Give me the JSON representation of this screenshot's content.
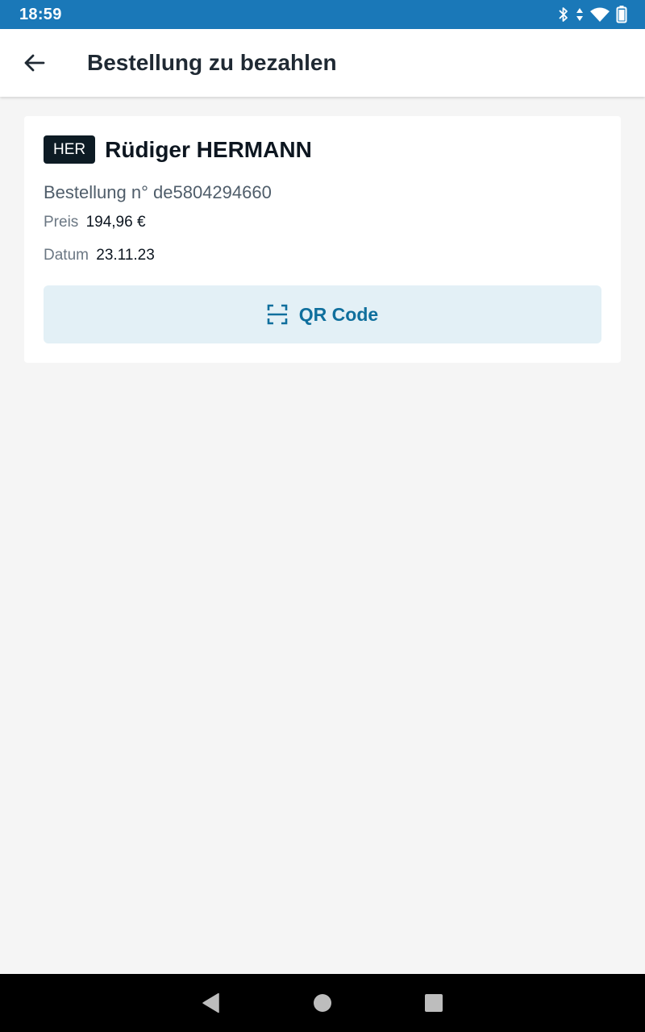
{
  "status_bar": {
    "time": "18:59",
    "icons": [
      "bluetooth-icon",
      "data-arrows-icon",
      "wifi-icon",
      "battery-icon"
    ]
  },
  "app_bar": {
    "back_icon": "arrow-left-icon",
    "title": "Bestellung zu bezahlen"
  },
  "order": {
    "badge": "HER",
    "customer_name": "Rüdiger HERMANN",
    "order_number_text": "Bestellung n° de5804294660",
    "price_label": "Preis",
    "price_value": "194,96 €",
    "date_label": "Datum",
    "date_value": "23.11.23",
    "qr_button_label": "QR Code",
    "qr_icon": "qr-scan-icon"
  },
  "colors": {
    "status_bar": "#1a78b8",
    "accent": "#0f6f9d",
    "button_bg": "#e3f0f6",
    "badge_bg": "#0d1b24",
    "background": "#f5f5f5"
  },
  "nav_bar": {
    "icons": [
      "back-triangle-icon",
      "home-circle-icon",
      "recents-square-icon"
    ]
  }
}
